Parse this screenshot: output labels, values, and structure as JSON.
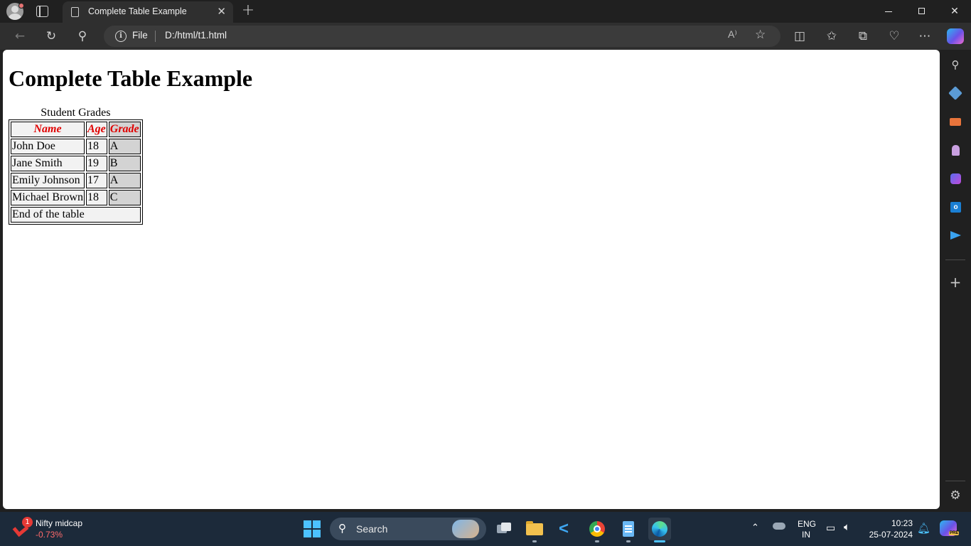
{
  "browser": {
    "tab_title": "Complete Table Example",
    "tab_close_glyph": "✕",
    "new_tab_glyph": "+",
    "address_scheme": "File",
    "address_url": "D:/html/t1.html",
    "read_aloud_glyph": "A⁾",
    "favorite_glyph": "☆",
    "icons": [
      "back-icon",
      "reload-icon",
      "search-icon",
      "info-icon",
      "read-aloud-icon",
      "favorite-star-icon",
      "split-screen-icon",
      "favorites-icon",
      "collections-icon",
      "browser-essentials-icon",
      "more-icon",
      "copilot-icon"
    ]
  },
  "page": {
    "heading": "Complete Table Example",
    "table": {
      "caption": "Student Grades",
      "headers": [
        "Name",
        "Age",
        "Grade"
      ],
      "rows": [
        {
          "name": "John Doe",
          "age": "18",
          "grade": "A"
        },
        {
          "name": "Jane Smith",
          "age": "19",
          "grade": "B"
        },
        {
          "name": "Emily Johnson",
          "age": "17",
          "grade": "A"
        },
        {
          "name": "Michael Brown",
          "age": "18",
          "grade": "C"
        }
      ],
      "footer": "End of the table"
    },
    "colors": {
      "header_text": "#e00000",
      "cell_bg": "#f2f2f2",
      "grade_col_bg": "#d3d3d3"
    }
  },
  "sidebar": {
    "icons": [
      "search-icon",
      "shopping-tag-icon",
      "tools-icon",
      "games-icon",
      "microsoft-365-icon",
      "outlook-icon",
      "drop-send-icon",
      "add-icon",
      "settings-icon"
    ],
    "outlook_letter": "o"
  },
  "taskbar": {
    "widget": {
      "badge": "1",
      "title": "Nifty midcap",
      "change": "-0.73%"
    },
    "search_label": "Search",
    "tray": {
      "lang_line1": "ENG",
      "lang_line2": "IN",
      "time": "10:23",
      "date": "25-07-2024",
      "pre_label": "PRE"
    },
    "accent": "#4cc2ff"
  }
}
